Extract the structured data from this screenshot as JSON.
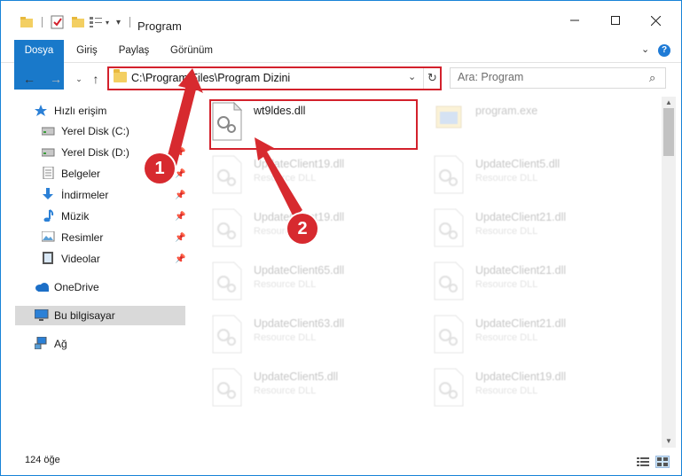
{
  "window": {
    "title": "Program",
    "accent_color": "#1979ca"
  },
  "ribbon": {
    "tabs": [
      "Dosya",
      "Giriş",
      "Paylaş",
      "Görünüm"
    ]
  },
  "address": {
    "path": "C:\\Program Files\\Program Dizini"
  },
  "search": {
    "placeholder": "Ara: Program"
  },
  "sidebar": {
    "items": [
      {
        "label": "Hızlı erişim",
        "icon": "star-icon",
        "pinned": false
      },
      {
        "label": "Yerel Disk (C:)",
        "icon": "drive-icon",
        "pinned": true
      },
      {
        "label": "Yerel Disk (D:)",
        "icon": "drive-icon",
        "pinned": true
      },
      {
        "label": "Belgeler",
        "icon": "document-icon",
        "pinned": true
      },
      {
        "label": "İndirmeler",
        "icon": "download-icon",
        "pinned": true
      },
      {
        "label": "Müzik",
        "icon": "music-icon",
        "pinned": true
      },
      {
        "label": "Resimler",
        "icon": "pictures-icon",
        "pinned": true
      },
      {
        "label": "Videolar",
        "icon": "video-icon",
        "pinned": true
      },
      {
        "label": "OneDrive",
        "icon": "cloud-icon",
        "pinned": false
      },
      {
        "label": "Bu bilgisayar",
        "icon": "computer-icon",
        "pinned": false,
        "selected": true
      },
      {
        "label": "Ağ",
        "icon": "network-icon",
        "pinned": false
      }
    ]
  },
  "files": {
    "left_column": [
      {
        "name": "wt9ldes.dll",
        "sub": ""
      },
      {
        "name": "UpdateClient19.dll",
        "sub": "Resource DLL"
      },
      {
        "name": "UpdateClient19.dll",
        "sub": "Resource DLL"
      },
      {
        "name": "UpdateClient65.dll",
        "sub": "Resource DLL"
      },
      {
        "name": "UpdateClient63.dll",
        "sub": "Resource DLL"
      },
      {
        "name": "UpdateClient5.dll",
        "sub": "Resource DLL"
      }
    ],
    "right_column": [
      {
        "name": "program.exe",
        "sub": ""
      },
      {
        "name": "UpdateClient5.dll",
        "sub": "Resource DLL"
      },
      {
        "name": "UpdateClient21.dll",
        "sub": "Resource DLL"
      },
      {
        "name": "UpdateClient21.dll",
        "sub": "Resource DLL"
      },
      {
        "name": "UpdateClient21.dll",
        "sub": "Resource DLL"
      },
      {
        "name": "UpdateClient19.dll",
        "sub": "Resource DLL"
      }
    ]
  },
  "status": {
    "count": "124 öğe"
  },
  "annotations": {
    "step1": "1",
    "step2": "2",
    "highlight_color": "#d3212c"
  }
}
